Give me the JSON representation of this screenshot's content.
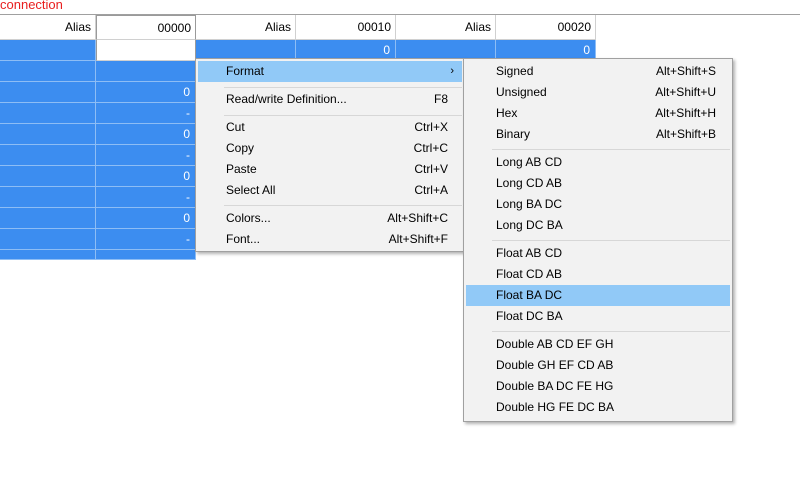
{
  "status_text": "connection",
  "grid": {
    "headers": [
      "Alias",
      "00000",
      "Alias",
      "00010",
      "Alias",
      "00020"
    ],
    "rows": [
      [
        "",
        "",
        "",
        "0",
        "",
        "0"
      ],
      [
        "",
        "",
        "",
        "",
        "",
        ""
      ],
      [
        "",
        "0",
        "",
        "",
        "",
        ""
      ],
      [
        "",
        "-",
        "",
        "",
        "",
        ""
      ],
      [
        "",
        "0",
        "",
        "",
        "",
        ""
      ],
      [
        "",
        "-",
        "",
        "",
        "",
        ""
      ],
      [
        "",
        "0",
        "",
        "",
        "",
        ""
      ],
      [
        "",
        "-",
        "",
        "",
        "",
        ""
      ],
      [
        "",
        "0",
        "",
        "",
        "",
        ""
      ],
      [
        "",
        "-",
        "",
        "",
        "",
        ""
      ]
    ]
  },
  "context_menu": {
    "items": [
      {
        "label": "Format",
        "shortcut": "",
        "has_submenu": true
      },
      {
        "label": "Read/write Definition...",
        "shortcut": "F8"
      },
      {
        "label": "Cut",
        "shortcut": "Ctrl+X"
      },
      {
        "label": "Copy",
        "shortcut": "Ctrl+C"
      },
      {
        "label": "Paste",
        "shortcut": "Ctrl+V"
      },
      {
        "label": "Select All",
        "shortcut": "Ctrl+A"
      },
      {
        "label": "Colors...",
        "shortcut": "Alt+Shift+C"
      },
      {
        "label": "Font...",
        "shortcut": "Alt+Shift+F"
      }
    ],
    "submenu_arrow": "›"
  },
  "format_submenu": {
    "items": [
      {
        "label": "Signed",
        "shortcut": "Alt+Shift+S"
      },
      {
        "label": "Unsigned",
        "shortcut": "Alt+Shift+U"
      },
      {
        "label": "Hex",
        "shortcut": "Alt+Shift+H"
      },
      {
        "label": "Binary",
        "shortcut": "Alt+Shift+B"
      },
      {
        "label": "Long AB CD",
        "shortcut": ""
      },
      {
        "label": "Long CD AB",
        "shortcut": ""
      },
      {
        "label": "Long BA DC",
        "shortcut": ""
      },
      {
        "label": "Long DC BA",
        "shortcut": ""
      },
      {
        "label": "Float AB CD",
        "shortcut": ""
      },
      {
        "label": "Float CD AB",
        "shortcut": ""
      },
      {
        "label": "Float BA DC",
        "shortcut": ""
      },
      {
        "label": "Float DC BA",
        "shortcut": ""
      },
      {
        "label": "Double AB CD EF GH",
        "shortcut": ""
      },
      {
        "label": "Double GH EF CD AB",
        "shortcut": ""
      },
      {
        "label": "Double BA DC FE HG",
        "shortcut": ""
      },
      {
        "label": "Double HG FE DC BA",
        "shortcut": ""
      }
    ],
    "highlighted": "Float BA DC"
  },
  "colors": {
    "selection": "#3c8df0",
    "menu_highlight": "#91c9f7",
    "status_text": "#e81e1e"
  }
}
